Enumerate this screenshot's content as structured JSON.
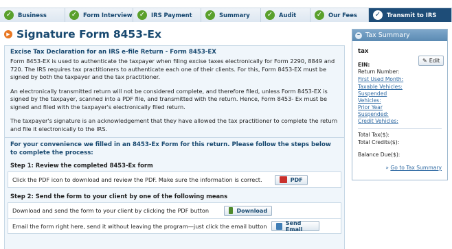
{
  "wizard": {
    "steps": [
      {
        "label": "Business",
        "state": "done"
      },
      {
        "label": "Form Interview",
        "state": "done"
      },
      {
        "label": "IRS Payment",
        "state": "done"
      },
      {
        "label": "Summary",
        "state": "done"
      },
      {
        "label": "Audit",
        "state": "done"
      },
      {
        "label": "Our Fees",
        "state": "done"
      },
      {
        "label": "Transmit to IRS",
        "state": "active"
      }
    ]
  },
  "page": {
    "title": "Signature Form 8453-Ex"
  },
  "main": {
    "heading": "Excise Tax Declaration for an IRS e-file Return - Form 8453-EX",
    "para1": "Form 8453-EX is used to authenticate the taxpayer when filing excise taxes electronically for Form 2290, 8849 and 720. The IRS requires tax practitioners to authenticate each one of their clients. For this, Form 8453-EX must be signed by both the taxpayer and the tax practitioner.",
    "para2": "An electronically transmitted return will not be considered complete, and therefore filed, unless Form 8453-EX is signed by the taxpayer, scanned into a PDF file, and transmitted with the return. Hence, Form 8453- Ex must be signed and filed with the taxpayer's electronically filed return.",
    "para3": "The taxpayer's signature is an acknowledgement that they have allowed the tax practitioner to complete the return and file it electronically to the IRS.",
    "convenience": "For your convenience we filled in an 8453-Ex Form for this return. Please follow the steps below to complete the process:",
    "step1": {
      "heading": "Step 1: Review the completed 8453-Ex form",
      "text": "Click the PDF icon to download and review the PDF. Make sure the information is correct.",
      "button": "PDF"
    },
    "step2": {
      "heading": "Step 2: Send the form to your client by one of the following means",
      "download_text": "Download and send the form to your client by clicking the PDF button",
      "download_button": "Download",
      "email_text": "Email the form right here, send it without leaving the program—just click the email button",
      "email_button": "Send Email"
    }
  },
  "sidebar": {
    "title": "Tax Summary",
    "tax_name": "tax",
    "edit_label": "Edit",
    "ein_label": "EIN:",
    "return_number_label": "Return Number:",
    "first_used_month": "First Used Month:",
    "taxable_vehicles": "Taxable Vehicles:",
    "suspended_vehicles": "Suspended Vehicles:",
    "prior_year_suspended": "Prior Year Suspended:",
    "credit_vehicles": "Credit Vehicles:",
    "total_tax": "Total Tax($):",
    "total_credits": "Total Credits($):",
    "balance_due": "Balance Due($):",
    "goto_link": "Go to Tax Summary",
    "goto_prefix": "»"
  },
  "colors": {
    "brand": "#17486f",
    "active_step": "#1e4d78",
    "check": "#5aa02c",
    "link": "#2f6aa3",
    "title_icon": "#e87722"
  },
  "icons": {
    "step_check": "check-circle-icon",
    "title": "arrow-circle-icon",
    "pdf": "pdf-icon",
    "download": "download-icon",
    "email": "email-icon",
    "edit": "pencil-icon",
    "collapse": "minus-circle-icon"
  }
}
